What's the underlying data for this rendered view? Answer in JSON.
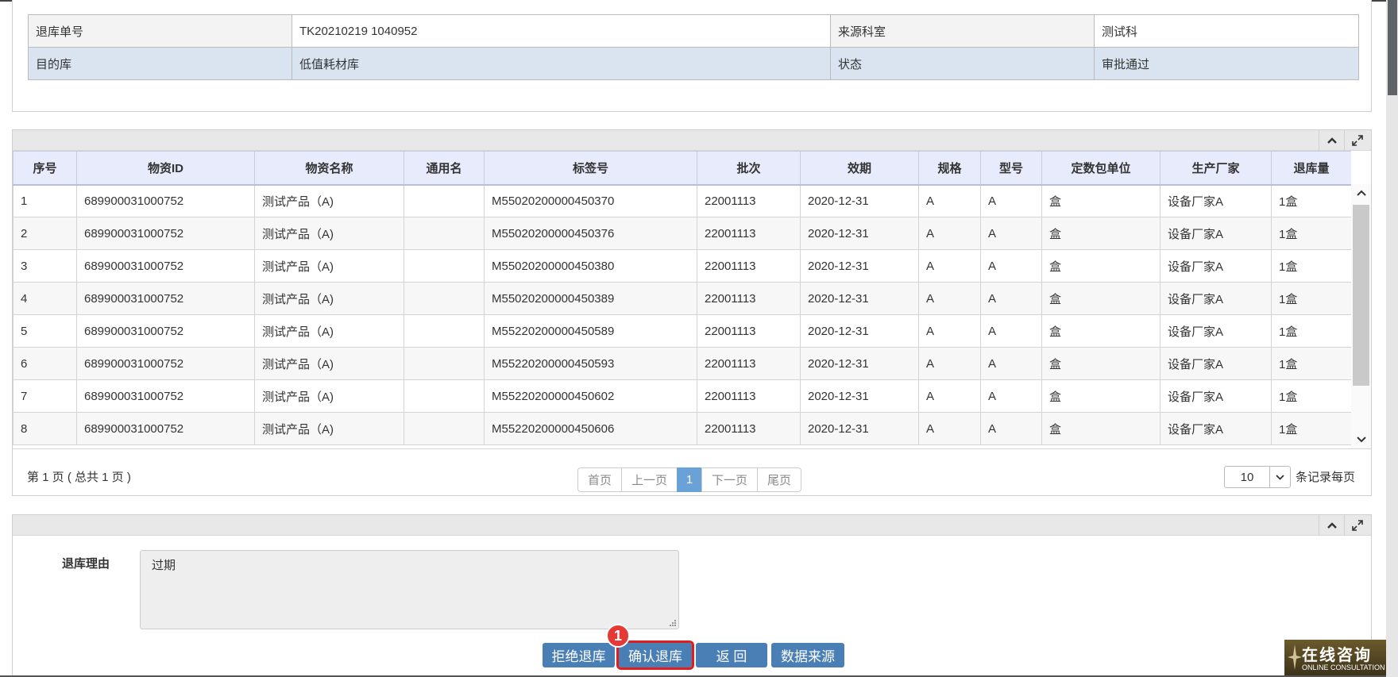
{
  "info": {
    "rows": [
      [
        "退库单号",
        "TK20210219 1040952",
        "来源科室",
        "测试科"
      ],
      [
        "目的库",
        "低值耗材库",
        "状态",
        "审批通过"
      ]
    ]
  },
  "grid": {
    "columns": [
      "序号",
      "物资ID",
      "物资名称",
      "通用名",
      "标签号",
      "批次",
      "效期",
      "规格",
      "型号",
      "定数包单位",
      "生产厂家",
      "退库量"
    ],
    "rows": [
      [
        "1",
        "689900031000752",
        "测试产品（A)",
        "",
        "M55020200000450370",
        "22001113",
        "2020-12-31",
        "A",
        "A",
        "盒",
        "设备厂家A",
        "1盒"
      ],
      [
        "2",
        "689900031000752",
        "测试产品（A)",
        "",
        "M55020200000450376",
        "22001113",
        "2020-12-31",
        "A",
        "A",
        "盒",
        "设备厂家A",
        "1盒"
      ],
      [
        "3",
        "689900031000752",
        "测试产品（A)",
        "",
        "M55020200000450380",
        "22001113",
        "2020-12-31",
        "A",
        "A",
        "盒",
        "设备厂家A",
        "1盒"
      ],
      [
        "4",
        "689900031000752",
        "测试产品（A)",
        "",
        "M55020200000450389",
        "22001113",
        "2020-12-31",
        "A",
        "A",
        "盒",
        "设备厂家A",
        "1盒"
      ],
      [
        "5",
        "689900031000752",
        "测试产品（A)",
        "",
        "M55220200000450589",
        "22001113",
        "2020-12-31",
        "A",
        "A",
        "盒",
        "设备厂家A",
        "1盒"
      ],
      [
        "6",
        "689900031000752",
        "测试产品（A)",
        "",
        "M55220200000450593",
        "22001113",
        "2020-12-31",
        "A",
        "A",
        "盒",
        "设备厂家A",
        "1盒"
      ],
      [
        "7",
        "689900031000752",
        "测试产品（A)",
        "",
        "M55220200000450602",
        "22001113",
        "2020-12-31",
        "A",
        "A",
        "盒",
        "设备厂家A",
        "1盒"
      ],
      [
        "8",
        "689900031000752",
        "测试产品（A)",
        "",
        "M55220200000450606",
        "22001113",
        "2020-12-31",
        "A",
        "A",
        "盒",
        "设备厂家A",
        "1盒"
      ]
    ]
  },
  "pager": {
    "info": "第 1 页 ( 总共 1 页 )",
    "first": "首页",
    "prev": "上一页",
    "current": "1",
    "next": "下一页",
    "last": "尾页",
    "page_size": "10",
    "per_page_label": "条记录每页"
  },
  "reason": {
    "label": "退库理由",
    "value": "过期"
  },
  "actions": {
    "reject": "拒绝退库",
    "confirm": "确认退库",
    "back": "返 回",
    "source": "数据来源"
  },
  "marker": "1",
  "consult": {
    "title": "在线咨询",
    "subtitle": "ONLINE CONSULTATION"
  },
  "icons": {
    "collapse": "chevron-up-icon",
    "expand": "expand-icon"
  }
}
